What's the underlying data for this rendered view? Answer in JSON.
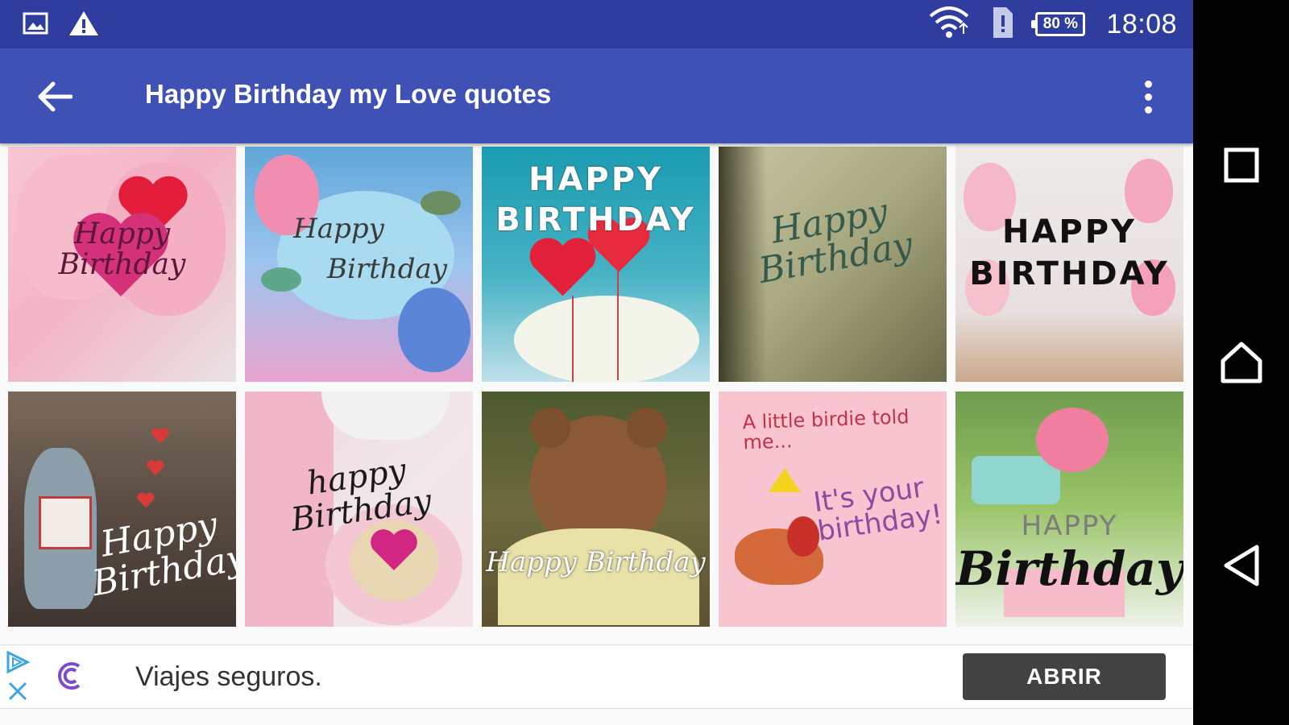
{
  "status_bar": {
    "time": "18:08",
    "battery": "80 %",
    "icons": [
      "image-icon",
      "warning-icon",
      "wifi-icon",
      "sim-alert-icon",
      "battery-icon"
    ]
  },
  "app_bar": {
    "title": "Happy Birthday my Love quotes",
    "back_icon": "arrow-back-icon",
    "menu_icon": "more-vert-icon"
  },
  "grid": {
    "tiles": [
      {
        "line1": "Happy",
        "line2": "Birthday"
      },
      {
        "line1": "Happy",
        "line2": "Birthday"
      },
      {
        "line1": "HAPPY",
        "line2": "BIRTHDAY"
      },
      {
        "line1": "Happy",
        "line2": "Birthday"
      },
      {
        "line1": "HAPPY",
        "line2": "BIRTHDAY"
      },
      {
        "line1": "Happy",
        "line2": "Birthday"
      },
      {
        "line1": "happy",
        "line2": "Birthday"
      },
      {
        "line1": "Happy Birthday",
        "line2": ""
      },
      {
        "line1": "A little birdie told me...",
        "line2": "It's your birthday!"
      },
      {
        "line1": "HAPPY",
        "line2": "Birthday"
      }
    ]
  },
  "ad": {
    "text": "Viajes seguros.",
    "button": "ABRIR"
  },
  "nav_bar": {
    "icons": [
      "recents-square-icon",
      "home-icon",
      "back-triangle-icon"
    ]
  },
  "colors": {
    "status_bar": "#2f3e9e",
    "app_bar": "#3f51b5",
    "ad_button": "#424242"
  }
}
